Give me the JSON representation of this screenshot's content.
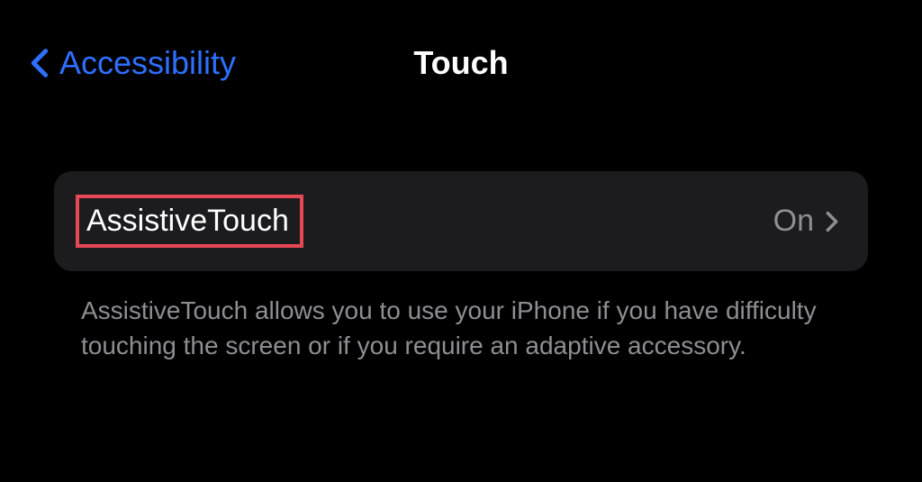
{
  "header": {
    "back_label": "Accessibility",
    "title": "Touch"
  },
  "settings": {
    "row": {
      "label": "AssistiveTouch",
      "value": "On"
    },
    "footer": "AssistiveTouch allows you to use your iPhone if you have difficulty touching the screen or if you require an adaptive accessory."
  },
  "colors": {
    "accent": "#2f6fff",
    "highlight": "#e74856",
    "secondary": "#8e8e93",
    "row_bg": "#1c1c1e"
  }
}
